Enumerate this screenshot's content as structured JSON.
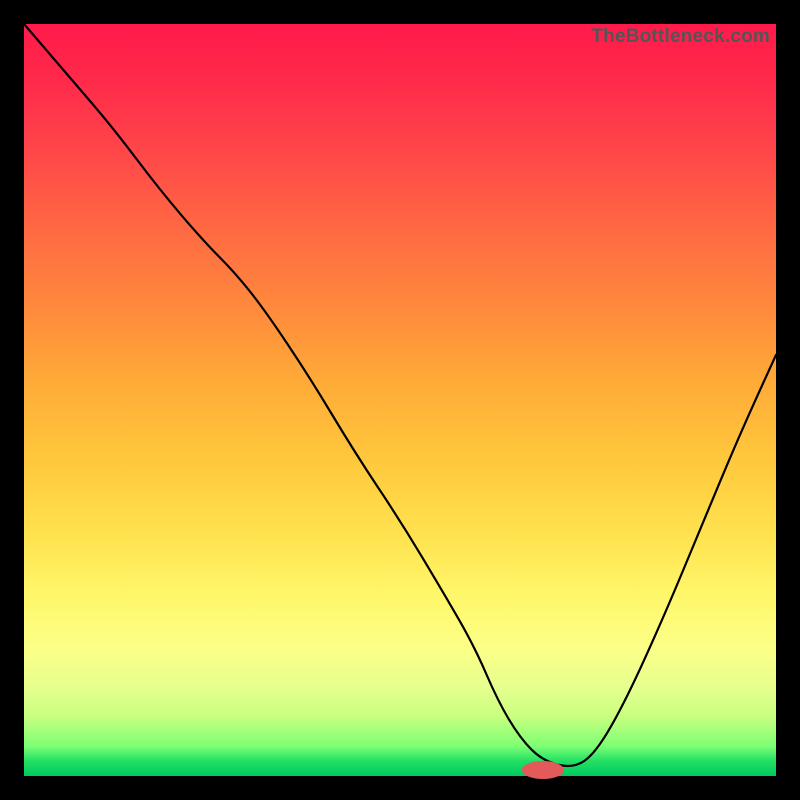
{
  "watermark": "TheBottleneck.com",
  "colors": {
    "frame": "#000000",
    "curve": "#000000",
    "marker": "#e25a5a"
  },
  "chart_data": {
    "type": "line",
    "title": "",
    "xlabel": "",
    "ylabel": "",
    "xlim": [
      0,
      100
    ],
    "ylim": [
      0,
      100
    ],
    "grid": false,
    "legend": false,
    "note": "Values are proportional to the 752x752 plotting area; y measured from the top. Lower y ⇒ closer to bottom (better / lower bottleneck).",
    "series": [
      {
        "name": "curve",
        "x": [
          0,
          6,
          12,
          18,
          24,
          28,
          32,
          38,
          44,
          50,
          56,
          60,
          63,
          66,
          69,
          73,
          76,
          80,
          85,
          90,
          95,
          100
        ],
        "y": [
          0,
          7,
          14,
          22,
          29,
          33,
          38,
          47,
          57,
          66,
          76,
          83,
          90,
          95,
          98,
          99,
          97,
          90,
          79,
          67,
          55,
          44
        ]
      }
    ],
    "marker": {
      "x": 69,
      "y": 99.2,
      "rx": 2.8,
      "ry": 1.2
    }
  }
}
